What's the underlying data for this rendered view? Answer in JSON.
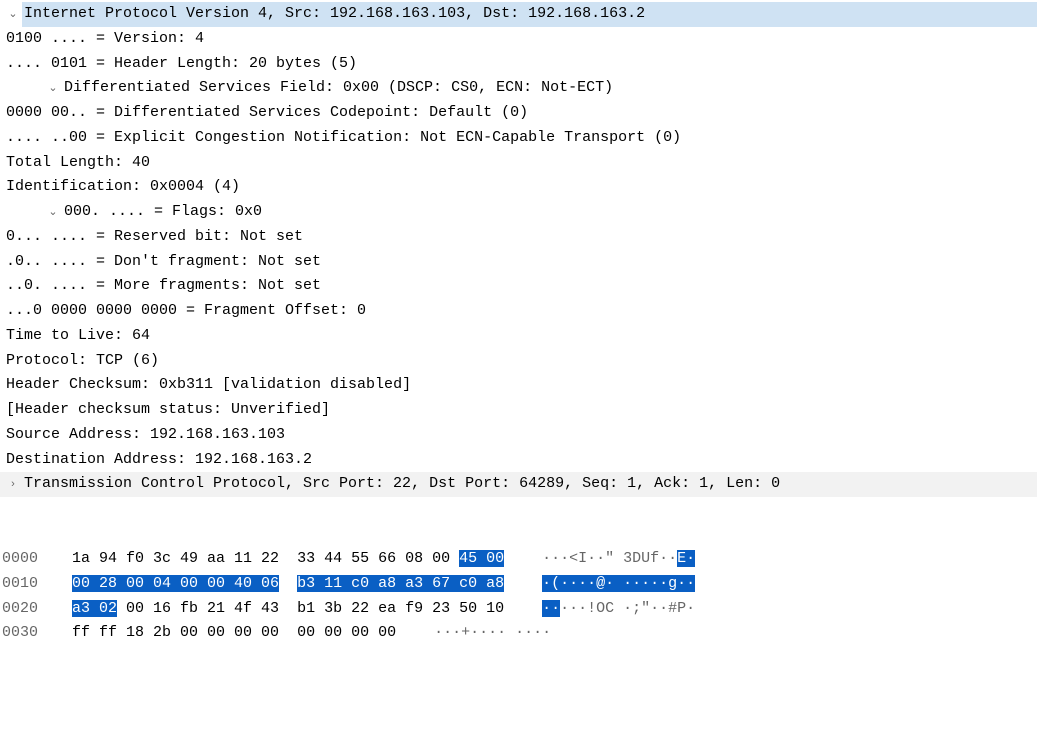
{
  "tree": {
    "ipv4_header": "Internet Protocol Version 4, Src: 192.168.163.103, Dst: 192.168.163.2",
    "version": "0100 .... = Version: 4",
    "hdrlen": ".... 0101 = Header Length: 20 bytes (5)",
    "dsfield": "Differentiated Services Field: 0x00 (DSCP: CS0, ECN: Not-ECT)",
    "dscp": "0000 00.. = Differentiated Services Codepoint: Default (0)",
    "ecn": ".... ..00 = Explicit Congestion Notification: Not ECN-Capable Transport (0)",
    "totallen": "Total Length: 40",
    "ident": "Identification: 0x0004 (4)",
    "flags": "000. .... = Flags: 0x0",
    "reserved": "0... .... = Reserved bit: Not set",
    "df": ".0.. .... = Don't fragment: Not set",
    "mf": "..0. .... = More fragments: Not set",
    "fragoff": "...0 0000 0000 0000 = Fragment Offset: 0",
    "ttl": "Time to Live: 64",
    "proto": "Protocol: TCP (6)",
    "cksum": "Header Checksum: 0xb311 [validation disabled]",
    "cksum_status": "[Header checksum status: Unverified]",
    "srcaddr": "Source Address: 192.168.163.103",
    "dstaddr": "Destination Address: 192.168.163.2",
    "tcp_header": "Transmission Control Protocol, Src Port: 22, Dst Port: 64289, Seq: 1, Ack: 1, Len: 0"
  },
  "hex": {
    "r0": {
      "offset": "0000",
      "b1": "1a 94 f0 3c 49 aa 11 22",
      "gap": "  ",
      "b2a": "33 44 55 66 08 00 ",
      "b2h": "45 00",
      "a1": "···<I··\"",
      "a2a": " 3DUf··",
      "a2h": "E·"
    },
    "r1": {
      "offset": "0010",
      "b1h": "00 28 00 04 00 00 40 06",
      "gap": "  ",
      "b2h": "b3 11 c0 a8 a3 67 c0 a8",
      "a1h": "·(····@·",
      "a2h": " ·····g··"
    },
    "r2": {
      "offset": "0020",
      "b1h": "a3 02",
      "b1": " 00 16 fb 21 4f 43",
      "gap": "  ",
      "b2": "b1 3b 22 ea f9 23 50 10",
      "a1h": "··",
      "a1": "···!OC",
      "a2": " ·;\"··#P·"
    },
    "r3": {
      "offset": "0030",
      "b1": "ff ff 18 2b 00 00 00 00",
      "gap": "  ",
      "b2": "00 00 00 00",
      "a1": "···+····",
      "a2": " ····"
    }
  }
}
